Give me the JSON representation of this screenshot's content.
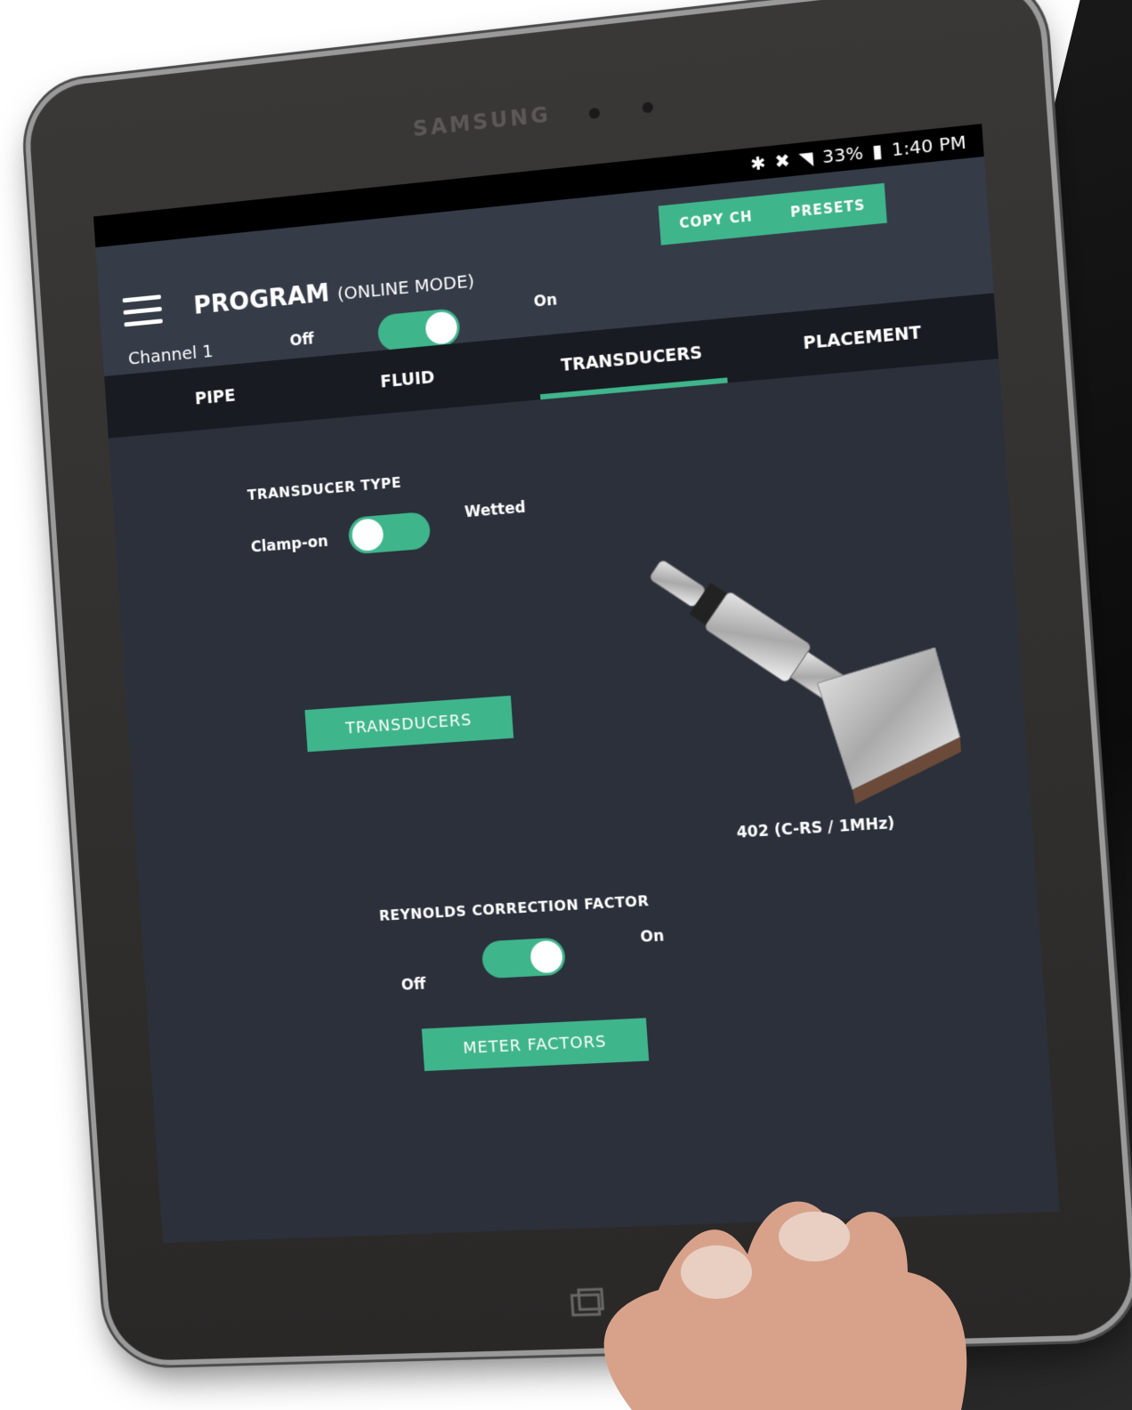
{
  "device": {
    "brand": "SAMSUNG"
  },
  "statusbar": {
    "icons": [
      "bluetooth-icon",
      "mute-icon",
      "wifi-icon",
      "battery-icon"
    ],
    "battery": "33%",
    "time": "1:40 PM"
  },
  "appbar": {
    "title": "PROGRAM",
    "subtitle": "(ONLINE MODE)",
    "copy_label": "COPY CH",
    "presets_label": "PRESETS",
    "channel_label": "Channel 1",
    "channel_off": "Off",
    "channel_on": "On",
    "channel_state": "on"
  },
  "tabs": [
    {
      "label": "PIPE"
    },
    {
      "label": "FLUID"
    },
    {
      "label": "TRANSDUCERS"
    },
    {
      "label": "PLACEMENT"
    }
  ],
  "active_tab": "TRANSDUCERS",
  "transducer": {
    "section_label": "TRANSDUCER TYPE",
    "left_label": "Clamp-on",
    "right_label": "Wetted",
    "state": "Clamp-on",
    "button_label": "TRANSDUCERS",
    "model_caption": "402 (C-RS / 1MHz)"
  },
  "reynolds": {
    "section_label": "REYNOLDS CORRECTION FACTOR",
    "off_label": "Off",
    "on_label": "On",
    "state": "on",
    "button_label": "METER FACTORS"
  },
  "colors": {
    "accent": "#3fb58b",
    "background": "#2b303b",
    "appbar": "#353b47",
    "tabbar": "#181b21"
  }
}
